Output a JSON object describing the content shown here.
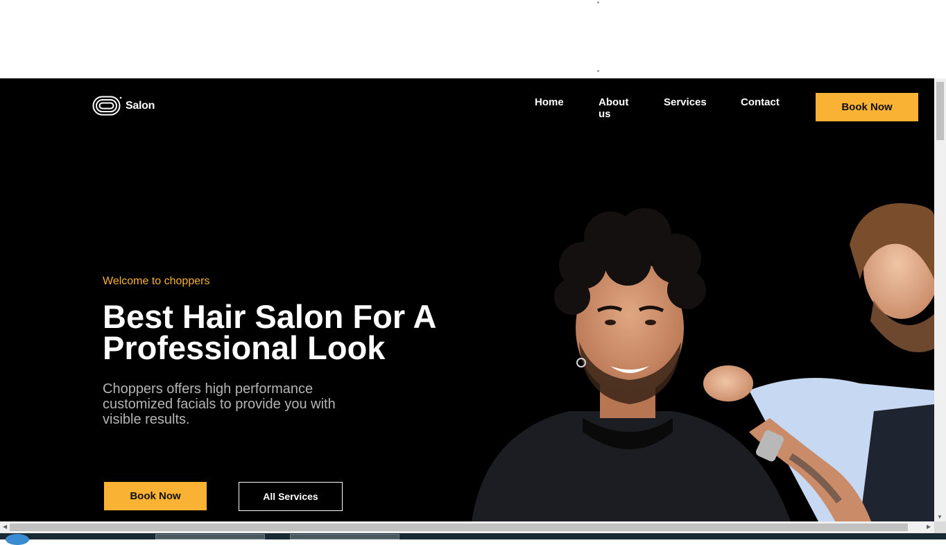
{
  "brand": {
    "name": "Salon"
  },
  "nav": {
    "items": [
      {
        "label": "Home"
      },
      {
        "label": "About us"
      },
      {
        "label": "Services"
      },
      {
        "label": "Contact"
      }
    ],
    "cta_label": "Book Now"
  },
  "hero": {
    "eyebrow": "Welcome to choppers",
    "title": "Best Hair Salon For A Professional Look",
    "description": "Choppers offers high performance customized facials to provide you with visible results.",
    "primary_button": "Book Now",
    "secondary_button": "All Services",
    "image_subject": "barber cutting curly-haired smiling client"
  },
  "colors": {
    "accent": "#f9b233",
    "background": "#000000",
    "text": "#ffffff",
    "muted_text": "#b5b5b5"
  },
  "icons": {
    "logo": "concentric-rounded-rect-logo-icon",
    "scroll_up": "triangle-up-icon",
    "scroll_down": "triangle-down-icon",
    "scroll_left": "triangle-left-icon",
    "scroll_right": "triangle-right-icon"
  }
}
